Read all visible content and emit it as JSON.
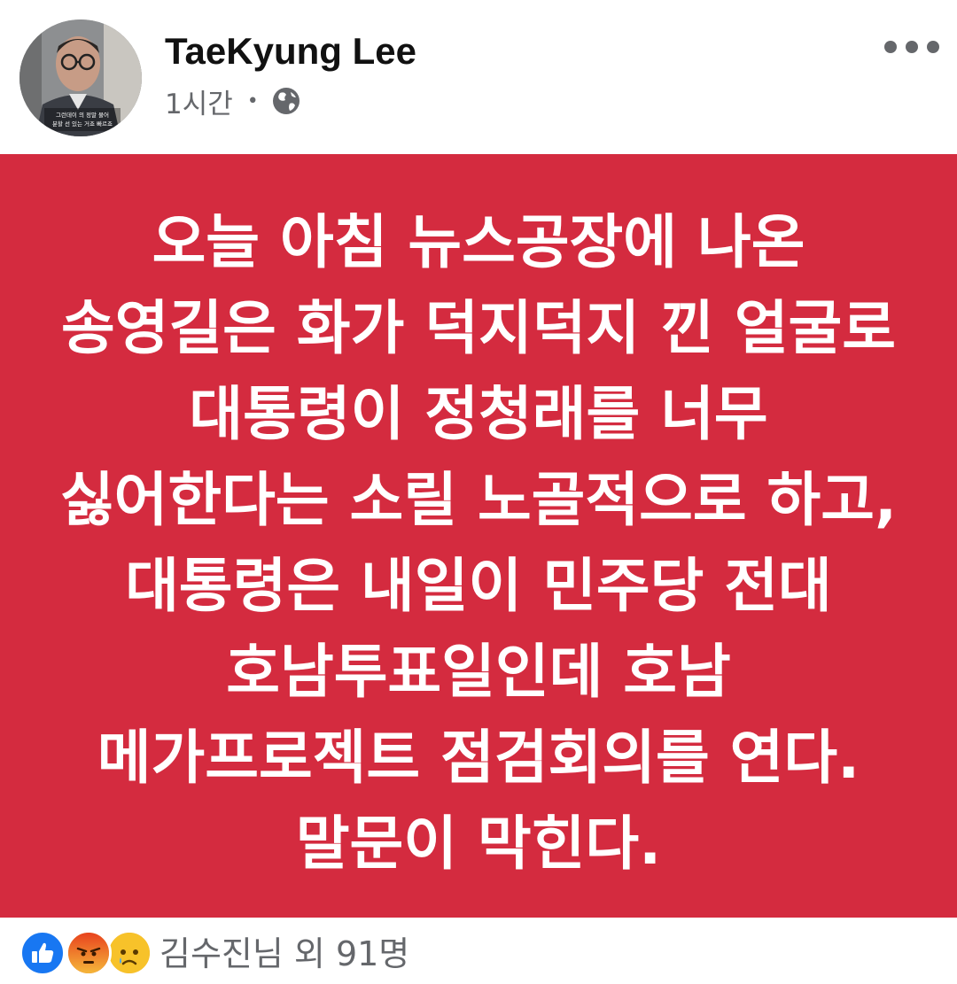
{
  "post": {
    "author": "TaeKyung Lee",
    "time": "1시간",
    "separator": "•",
    "privacy_icon": "globe-icon",
    "more_icon": "more-options-icon",
    "avatar_caption": [
      "그런데이 의 정말 물어",
      "분할 선 있는 거죠 빠르죠"
    ],
    "text_lines": [
      "오늘 아침 뉴스공장에 나온",
      "송영길은 화가 덕지덕지 낀 얼굴로",
      "대통령이 정청래를 너무",
      "싫어한다는 소릴 노골적으로 하고,",
      "대통령은 내일이 민주당 전대",
      "호남투표일인데 호남",
      "메가프로젝트 점검회의를 연다.",
      "말문이 막힌다."
    ],
    "background_color": "#d42b3f"
  },
  "reactions": {
    "icons": [
      "like-icon",
      "angry-icon",
      "sad-icon"
    ],
    "summary": "김수진님 외 91명"
  }
}
